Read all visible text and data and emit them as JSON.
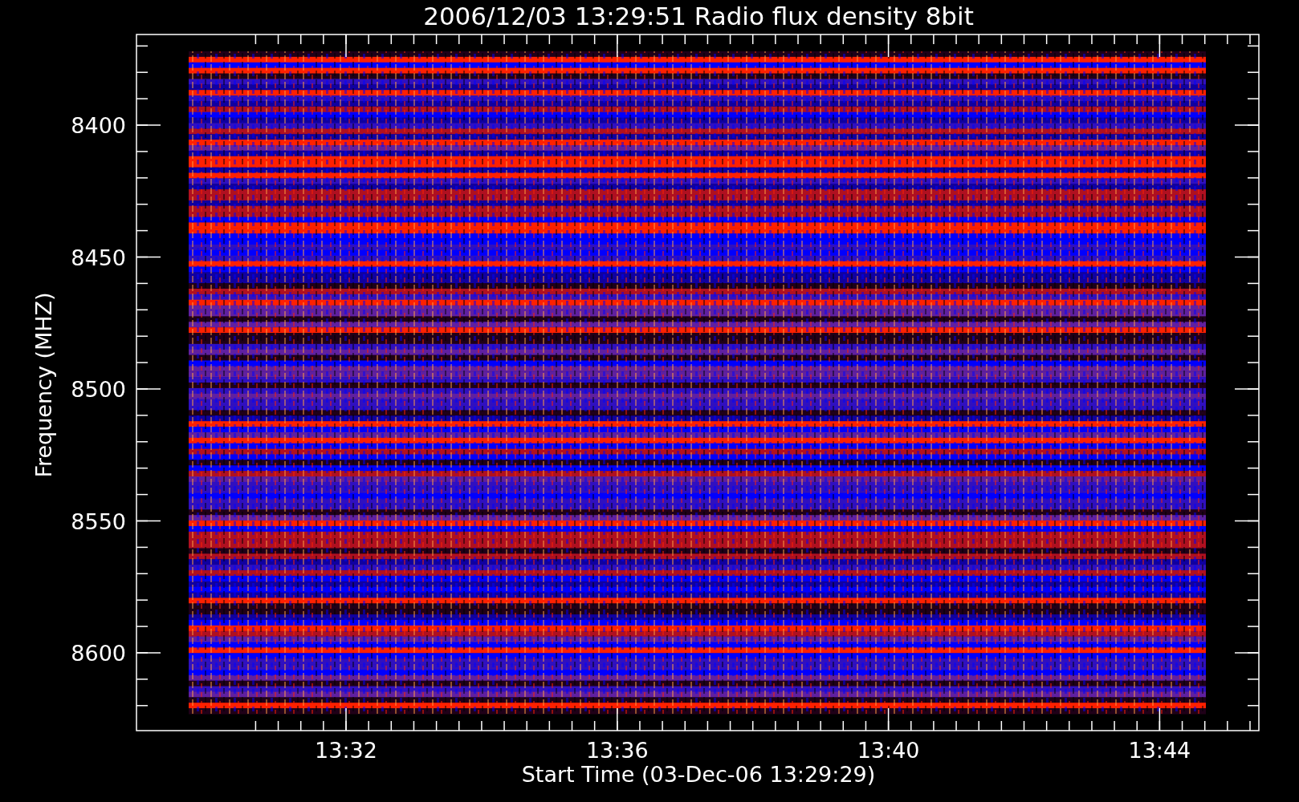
{
  "title": "2006/12/03 13:29:51 Radio flux density 8bit",
  "x_axis": {
    "label": "Start Time (03-Dec-06 13:29:29)",
    "ticks": [
      "13:32",
      "13:36",
      "13:40",
      "13:44"
    ]
  },
  "y_axis": {
    "label": "Frequency (MHZ)",
    "ticks": [
      "8400",
      "8450",
      "8500",
      "8550",
      "8600"
    ]
  }
}
